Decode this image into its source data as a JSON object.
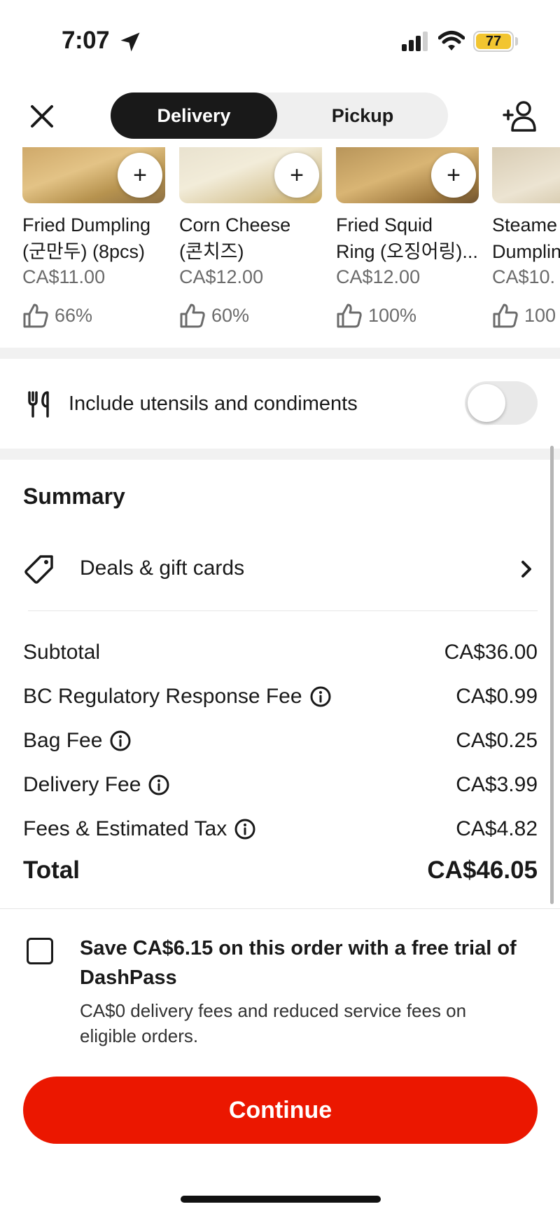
{
  "status_bar": {
    "time": "7:07",
    "battery": "77"
  },
  "header": {
    "tabs": {
      "delivery": "Delivery",
      "pickup": "Pickup"
    }
  },
  "recommended_items": [
    {
      "name": "Fried Dumpling\n(군만두) (8pcs)",
      "price": "CA$11.00",
      "rating": "66%"
    },
    {
      "name": "Corn Cheese\n(콘치즈)",
      "price": "CA$12.00",
      "rating": "60%"
    },
    {
      "name": "Fried Squid\nRing (오징어링)...",
      "price": "CA$12.00",
      "rating": "100%"
    },
    {
      "name": "Steame\nDumplin",
      "price": "CA$10.",
      "rating": "100"
    }
  ],
  "add_button_glyph": "+",
  "utensils": {
    "label": "Include utensils and condiments",
    "enabled": false
  },
  "summary": {
    "title": "Summary",
    "deals_label": "Deals & gift cards",
    "lines": [
      {
        "label": "Subtotal",
        "value": "CA$36.00"
      },
      {
        "label": "BC Regulatory Response Fee",
        "value": "CA$0.99"
      },
      {
        "label": "Bag Fee",
        "value": "CA$0.25"
      },
      {
        "label": "Delivery Fee",
        "value": "CA$3.99"
      },
      {
        "label": "Fees & Estimated Tax",
        "value": "CA$4.82"
      }
    ],
    "total_label": "Total",
    "total_value": "CA$46.05"
  },
  "dashpass": {
    "title": "Save CA$6.15 on this order with a free trial of DashPass",
    "description": "CA$0 delivery fees and reduced service fees on eligible orders.",
    "checked": false
  },
  "continue_label": "Continue",
  "colors": {
    "brand_red": "#eb1700",
    "battery_yellow": "#f2c530"
  }
}
